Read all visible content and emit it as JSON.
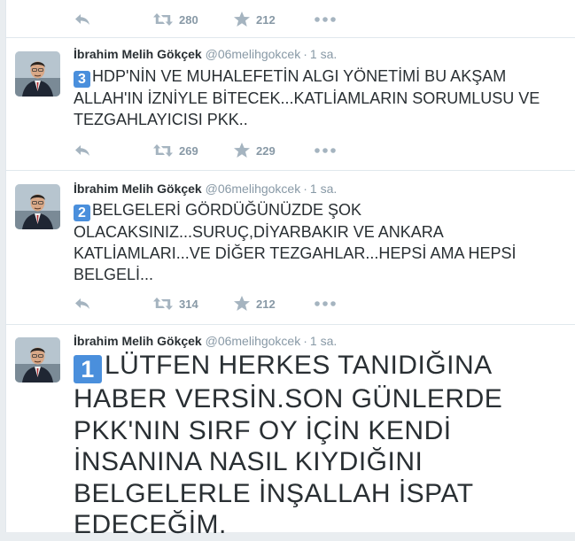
{
  "tweets": [
    {
      "retweets": "280",
      "favorites": "212"
    },
    {
      "fullname": "İbrahim Melih Gökçek",
      "screenname": "@06melihgokcek",
      "dot": "·",
      "time": "1 sa.",
      "number": "3",
      "text": "HDP'NİN VE MUHALEFETİN ALGI YÖNETİMİ BU AKŞAM ALLAH'IN İZNİYLE BİTECEK...KATLİAMLARIN SORUMLUSU VE TEZGAHLAYICISI PKK..",
      "retweets": "269",
      "favorites": "229"
    },
    {
      "fullname": "İbrahim Melih Gökçek",
      "screenname": "@06melihgokcek",
      "dot": "·",
      "time": "1 sa.",
      "number": "2",
      "text": "BELGELERİ GÖRDÜĞÜNÜZDE ŞOK OLACAKSINIZ...SURUÇ,DİYARBAKIR VE ANKARA KATLİAMLARI...VE DİĞER TEZGAHLAR...HEPSİ AMA HEPSİ BELGELİ...",
      "retweets": "314",
      "favorites": "212"
    },
    {
      "fullname": "İbrahim Melih Gökçek",
      "screenname": "@06melihgokcek",
      "dot": "·",
      "time": "1 sa.",
      "number": "1",
      "text": "LÜTFEN HERKES TANIDIĞINA HABER VERSİN.SON GÜNLERDE PKK'NIN SIRF OY İÇİN KENDİ İNSANINA NASIL KIYDIĞINI BELGELERLE İNŞALLAH İSPAT EDECEĞİM."
    }
  ],
  "icons": {
    "reply": "reply-icon",
    "retweet": "retweet-icon",
    "favorite": "star-icon",
    "more": "more-icon",
    "avatar": "avatar-photo"
  },
  "colors": {
    "icon": "#a5b4c0",
    "text": "#292f33",
    "muted": "#8899a6",
    "number_badge": "#4a8fdc",
    "page_bg": "#e9edf0"
  }
}
